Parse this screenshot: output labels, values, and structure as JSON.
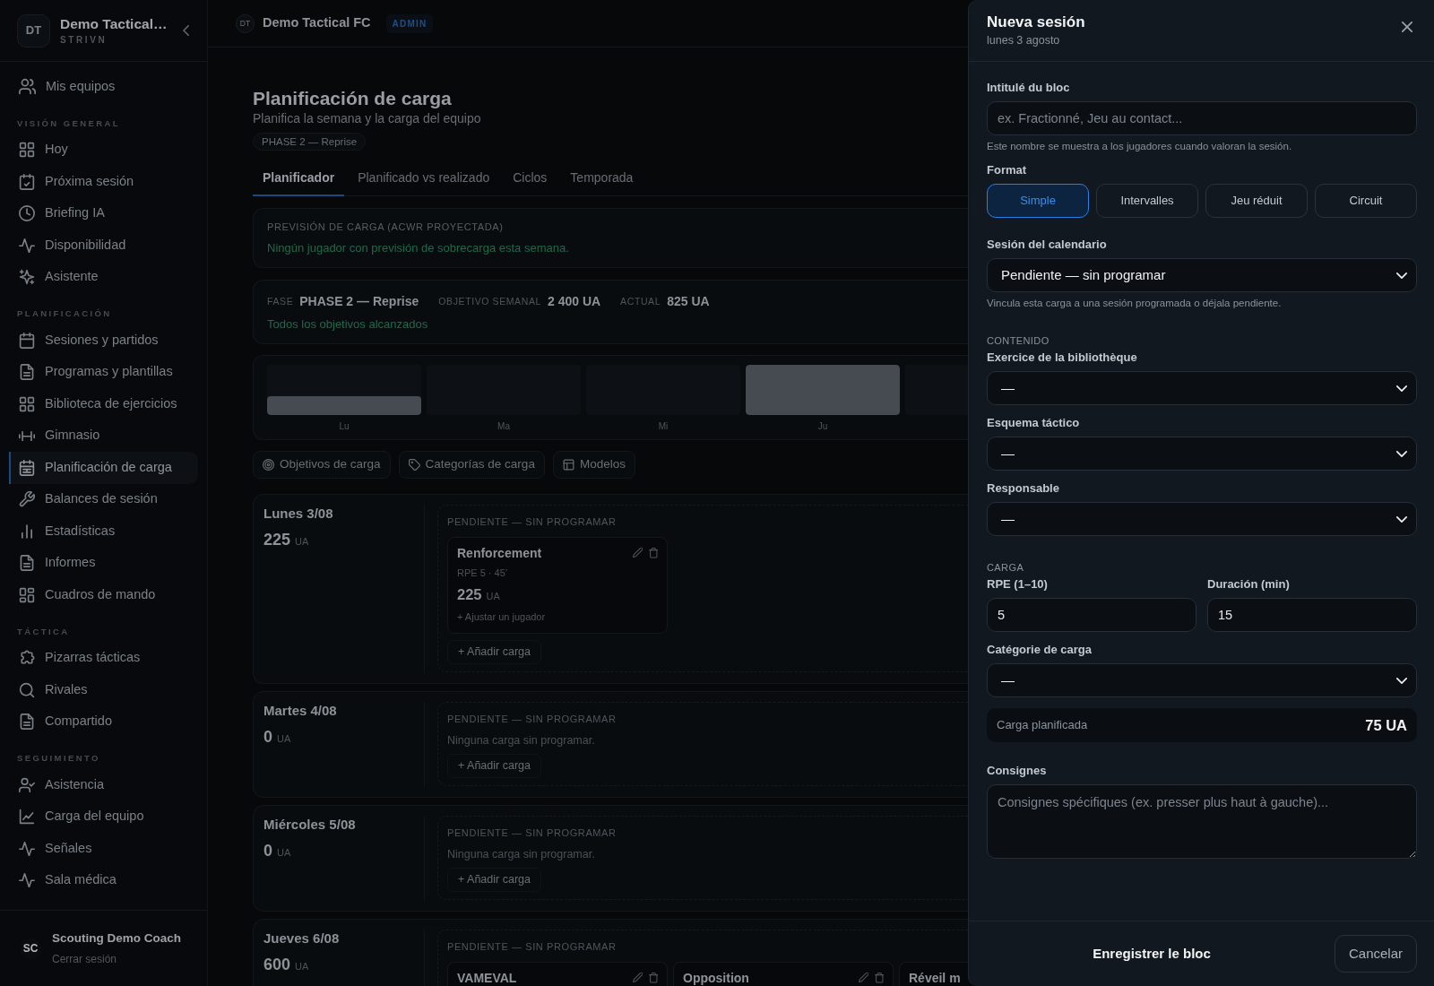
{
  "sidebar": {
    "team": {
      "avatar": "DT",
      "name": "Demo Tactical…",
      "org": "STRIVN"
    },
    "teams_link": {
      "label": "Mis equipos"
    },
    "sections": [
      {
        "title": "VISIÓN GENERAL",
        "items": [
          {
            "label": "Hoy",
            "selected": false
          },
          {
            "label": "Próxima sesión",
            "selected": false
          },
          {
            "label": "Briefing IA",
            "selected": false
          },
          {
            "label": "Disponibilidad",
            "selected": false
          },
          {
            "label": "Asistente",
            "selected": false
          }
        ]
      },
      {
        "title": "PLANIFICACIÓN",
        "items": [
          {
            "label": "Sesiones y partidos",
            "selected": false
          },
          {
            "label": "Programas y plantillas",
            "selected": false
          },
          {
            "label": "Biblioteca de ejercicios",
            "selected": false
          },
          {
            "label": "Gimnasio",
            "selected": false
          },
          {
            "label": "Planificación de carga",
            "selected": true
          },
          {
            "label": "Balances de sesión",
            "selected": false
          },
          {
            "label": "Estadísticas",
            "selected": false
          },
          {
            "label": "Informes",
            "selected": false
          },
          {
            "label": "Cuadros de mando",
            "selected": false
          }
        ]
      },
      {
        "title": "TÁCTICA",
        "items": [
          {
            "label": "Pizarras tácticas",
            "selected": false
          },
          {
            "label": "Rivales",
            "selected": false
          },
          {
            "label": "Compartido",
            "selected": false
          }
        ]
      },
      {
        "title": "SEGUIMIENTO",
        "items": [
          {
            "label": "Asistencia",
            "selected": false
          },
          {
            "label": "Carga del equipo",
            "selected": false
          },
          {
            "label": "Señales",
            "selected": false
          },
          {
            "label": "Sala médica",
            "selected": false
          }
        ]
      }
    ],
    "user": {
      "initials": "SC",
      "name": "Scouting Demo Coach",
      "action": "Cerrar sesión"
    }
  },
  "topbar": {
    "avatar": "DT",
    "team": "Demo Tactical FC",
    "role": "ADMIN"
  },
  "page": {
    "title": "Planificación de carga",
    "subtitle": "Planifica la semana y la carga del equipo",
    "phase": "PHASE 2 — Reprise"
  },
  "tabs": [
    {
      "label": "Planificador",
      "selected": true
    },
    {
      "label": "Planificado vs realizado",
      "selected": false
    },
    {
      "label": "Ciclos",
      "selected": false
    },
    {
      "label": "Temporada",
      "selected": false
    }
  ],
  "forecast": {
    "title": "PREVISIÓN DE CARGA (ACWR PROYECTADA)",
    "message": "Ningún jugador con previsión de sobrecarga esta semana."
  },
  "summary": {
    "stats": [
      {
        "label": "FASE",
        "value": "PHASE 2 — Reprise"
      },
      {
        "label": "OBJETIVO SEMANAL",
        "value": "2 400 UA"
      },
      {
        "label": "ACTUAL",
        "value": "825 UA"
      }
    ],
    "status": "Todos los objetivos alcanzados"
  },
  "week_chart": {
    "labels": [
      "Lu",
      "Ma",
      "Mi",
      "Ju"
    ]
  },
  "actions": [
    "Objetivos de carga",
    "Categorías de carga",
    "Modelos"
  ],
  "days": [
    {
      "name": "Lunes 3/08",
      "total": "225",
      "unit": "UA",
      "group": "PENDIENTE — SIN PROGRAMAR",
      "loads": [
        {
          "title": "Renforcement",
          "meta": "RPE 5 · 45’",
          "total": "225",
          "unit": "UA",
          "adjust": "+ Ajustar un jugador",
          "cut_off": false
        }
      ],
      "add": "+ Añadir carga"
    },
    {
      "name": "Martes 4/08",
      "total": "0",
      "unit": "UA",
      "group": "PENDIENTE — SIN PROGRAMAR",
      "empty": "Ninguna carga sin programar.",
      "add": "+ Añadir carga"
    },
    {
      "name": "Miércoles 5/08",
      "total": "0",
      "unit": "UA",
      "group": "PENDIENTE — SIN PROGRAMAR",
      "empty": "Ninguna carga sin programar.",
      "add": "+ Añadir carga"
    },
    {
      "name": "Jueves 6/08",
      "total": "600",
      "unit": "UA",
      "group": "PENDIENTE — SIN PROGRAMAR",
      "loads": [
        {
          "title": "VAMEVAL",
          "cut_off": false
        },
        {
          "title": "Opposition",
          "cut_off": false
        },
        {
          "title": "Réveil m",
          "cut_off": true
        }
      ]
    }
  ],
  "drawer": {
    "title": "Nueva sesión",
    "subtitle": "lunes 3 agosto",
    "blocks": [
      {
        "kind": "text",
        "label": "Intitulé du bloc",
        "placeholder": "ex. Fractionné, Jeu au contact...",
        "help": "Este nombre se muestra a los jugadores cuando valoran la sesión."
      },
      {
        "kind": "choice",
        "label": "Format",
        "options": [
          {
            "label": "Simple",
            "selected": true
          },
          {
            "label": "Intervalles",
            "selected": false
          },
          {
            "label": "Jeu réduit",
            "selected": false
          },
          {
            "label": "Circuit",
            "selected": false
          }
        ]
      },
      {
        "kind": "select",
        "label": "Sesión del calendario",
        "value": "Pendiente — sin programar",
        "help": "Vincula esta carga a una sesión programada o déjala pendiente."
      },
      {
        "kind": "heading",
        "text": "CONTENIDO"
      },
      {
        "kind": "select",
        "label": "Exercice de la bibliothèque",
        "value": "—"
      },
      {
        "kind": "select",
        "label": "Esquema táctico",
        "value": "—"
      },
      {
        "kind": "select",
        "label": "Responsable",
        "value": "—"
      },
      {
        "kind": "heading",
        "text": "CARGA"
      },
      {
        "kind": "pair",
        "fields": [
          {
            "label": "RPE (1–10)",
            "value": "5"
          },
          {
            "label": "Duración (min)",
            "value": "15"
          }
        ]
      },
      {
        "kind": "select",
        "label": "Catégorie de carga",
        "value": "—"
      },
      {
        "kind": "total",
        "label": "Carga planificada",
        "value": "75 UA"
      },
      {
        "kind": "textarea",
        "label": "Consignes",
        "placeholder": "Consignes spécifiques (ex. presser plus haut à gauche)..."
      }
    ],
    "footer": {
      "primary": "Enregistrer le bloc",
      "secondary": "Cancelar"
    }
  }
}
